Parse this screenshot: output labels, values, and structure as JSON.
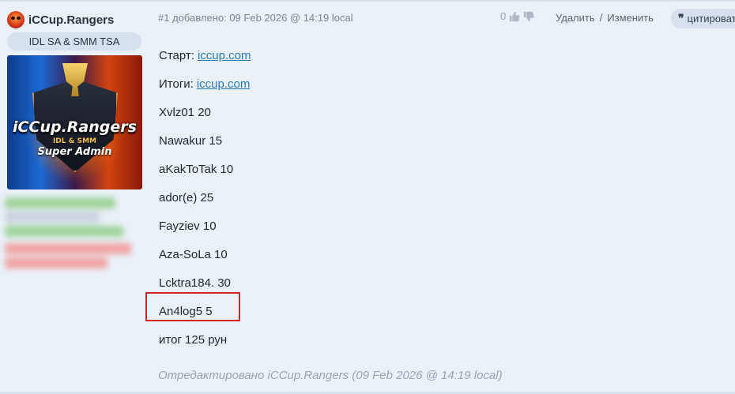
{
  "user": {
    "name": "iCCup.Rangers",
    "title": "IDL SA & SMM TSA",
    "avatar_text": [
      "iCCup.Rangers",
      "IDL & SMM",
      "Super Admin"
    ]
  },
  "post": {
    "meta": "#1 добавлено: 09 Feb 2026 @ 14:19 local",
    "rating": "0",
    "delete_label": "Удалить",
    "separator": "/",
    "edit_label": "Изменить",
    "quote_label": "цитировать",
    "lines": [
      {
        "prefix": "Старт:",
        "link": "iccup.com"
      },
      {
        "prefix": "Итоги:",
        "link": "iccup.com"
      },
      {
        "text": "Xvlz01 20"
      },
      {
        "text": "Nawakur 15"
      },
      {
        "text": "aKakToTak 10"
      },
      {
        "text": "ador(e) 25"
      },
      {
        "text": "Fayziev 10"
      },
      {
        "text": "Aza-SoLa 10"
      },
      {
        "text": "Lcktra184. 30"
      },
      {
        "text": "An4log5 5"
      },
      {
        "text": "итог 125 рун"
      }
    ],
    "edited_note": "Отредактировано iCCup.Rangers (09 Feb 2026 @ 14:19 local)"
  },
  "colors": {
    "background": "#eaf1f9",
    "link": "#2a7ab8",
    "highlight": "#d42626",
    "muted": "#9aa3b0"
  }
}
